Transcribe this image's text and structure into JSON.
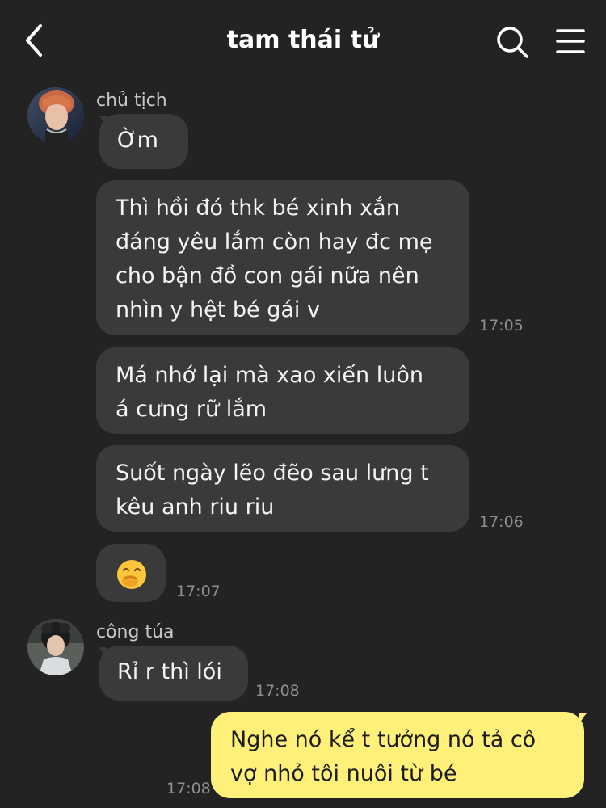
{
  "header": {
    "title": "tam thái tử",
    "back_icon": "chevron-left-icon",
    "search_icon": "search-icon",
    "menu_icon": "hamburger-menu-icon"
  },
  "messages": {
    "group1_sender": "chủ tịch",
    "m1": "Ờm",
    "m2": "Thì hồi đó thk bé xinh xắn\ngđáng yêu lắm còn hay đc mẹ\ncho bận đồ con gái nữa nên\nnhìn y hệt bé gái v",
    "m2_time": "17:05",
    "m3": "Má nhớ lại mà xao xiến luôn\ná cưng rữ lắm",
    "m4": "Suốt ngày lẽo đẽo sau lưng t\nkêu anh riu riu",
    "m4_time": "17:06",
    "m5_emoji": "hand-over-mouth-emoji",
    "m5_time": "17:07",
    "group2_sender": "công túa",
    "m6": "Rỉ r thì lói",
    "m6_time": "17:08",
    "m7": "Nghe nó kể t tưởng nó tả cô\nvợ nhỏ tôi nuôi từ bé",
    "m7_time": "17:08"
  },
  "colors": {
    "background": "#232323",
    "incoming_bubble": "#3a3a3a",
    "outgoing_bubble": "#fff07a",
    "timestamp": "#8f8f8f"
  }
}
